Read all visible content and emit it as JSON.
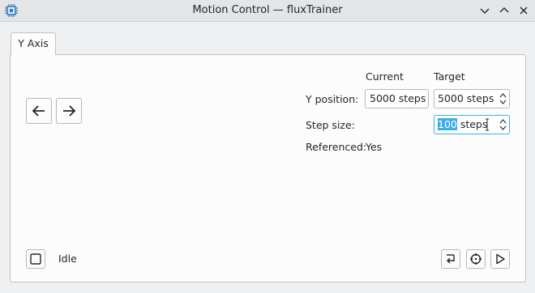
{
  "window": {
    "title": "Motion Control — fluxTrainer",
    "app_icon": "chip-icon",
    "buttons": [
      "minimize-icon",
      "maximize-icon",
      "close-icon"
    ]
  },
  "tabs": [
    {
      "label": "Y Axis",
      "active": true
    }
  ],
  "jog": {
    "left_icon": "arrow-left-icon",
    "right_icon": "arrow-right-icon"
  },
  "form": {
    "col_current": "Current",
    "col_target": "Target",
    "y_position_label": "Y position:",
    "current_value": "5000 steps",
    "target_value": "5000 steps",
    "step_size_label": "Step size:",
    "step_size_number": "100",
    "step_size_unit": " steps",
    "referenced_label": "Referenced:",
    "referenced_value": "Yes"
  },
  "status": {
    "stop_icon": "stop-square-icon",
    "text": "Idle"
  },
  "actions": {
    "icons": [
      "return-icon",
      "target-icon",
      "play-icon"
    ]
  },
  "colors": {
    "accent": "#3daee9",
    "background": "#eff0f1",
    "panel": "#fcfcfc"
  }
}
